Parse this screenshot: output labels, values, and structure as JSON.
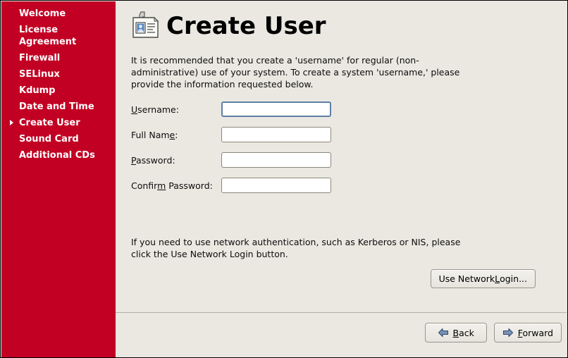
{
  "window": {
    "sidebar_color": "#c20023",
    "background_color": "#eae8e1",
    "focus_border_color": "#5d7fa6"
  },
  "sidebar": {
    "items": [
      {
        "label": "Welcome",
        "current": false
      },
      {
        "label": "License Agreement",
        "current": false
      },
      {
        "label": "Firewall",
        "current": false
      },
      {
        "label": "SELinux",
        "current": false
      },
      {
        "label": "Kdump",
        "current": false
      },
      {
        "label": "Date and Time",
        "current": false
      },
      {
        "label": "Create User",
        "current": true
      },
      {
        "label": "Sound Card",
        "current": false
      },
      {
        "label": "Additional CDs",
        "current": false
      }
    ]
  },
  "header": {
    "title": "Create User",
    "icon": "id-badge-icon"
  },
  "main": {
    "intro_text": "It is recommended that you create a 'username' for regular (non-administrative) use of your system. To create a system 'username,' please provide the information requested below.",
    "network_text": "If you need to use network authentication, such as Kerberos or NIS, please click the Use Network Login button.",
    "form": {
      "fields": [
        {
          "label_pre": "",
          "label_mnemonic": "U",
          "label_post": "sername:",
          "value": "",
          "placeholder": "",
          "focused": true,
          "type": "text",
          "name": "username"
        },
        {
          "label_pre": "Full Nam",
          "label_mnemonic": "e",
          "label_post": ":",
          "value": "",
          "placeholder": "",
          "focused": false,
          "type": "text",
          "name": "full-name"
        },
        {
          "label_pre": "",
          "label_mnemonic": "P",
          "label_post": "assword:",
          "value": "",
          "placeholder": "",
          "focused": false,
          "type": "password",
          "name": "password"
        },
        {
          "label_pre": "Confir",
          "label_mnemonic": "m",
          "label_post": " Password:",
          "value": "",
          "placeholder": "",
          "focused": false,
          "type": "password",
          "name": "confirm-password"
        }
      ]
    },
    "network_login_button": {
      "label_pre": "Use Network ",
      "label_mnemonic": "L",
      "label_post": "ogin..."
    }
  },
  "footer": {
    "back_button": {
      "label_pre": "",
      "label_mnemonic": "B",
      "label_post": "ack",
      "icon": "arrow-left-icon"
    },
    "forward_button": {
      "label_pre": "",
      "label_mnemonic": "F",
      "label_post": "orward",
      "icon": "arrow-right-icon"
    }
  }
}
